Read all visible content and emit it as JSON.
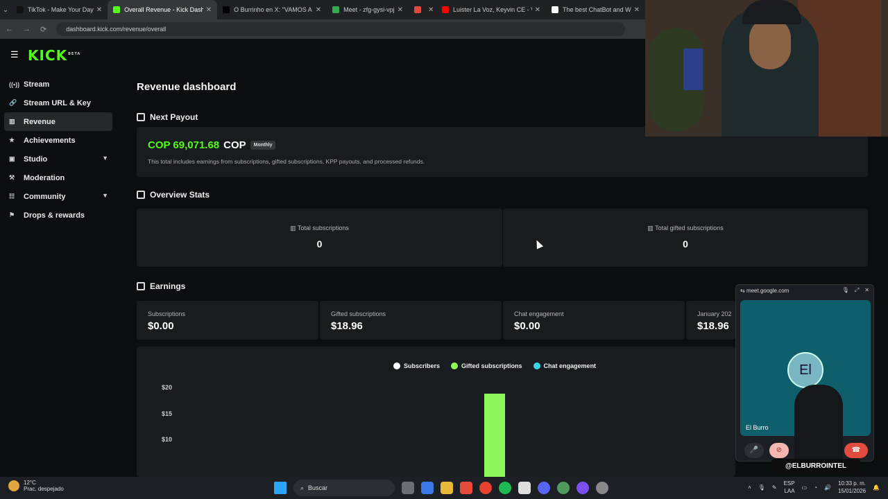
{
  "browser": {
    "tabs": [
      {
        "title": "TikTok - Make Your Day",
        "color": "#111111"
      },
      {
        "title": "Overall Revenue - Kick Dashbo",
        "color": "#53fc18"
      },
      {
        "title": "O Burrinho en X: \"VAMOS A Q",
        "color": "#000000"
      },
      {
        "title": "Meet - zfg-gysi-vpj",
        "color": "#34a853"
      },
      {
        "title": "",
        "color": "#e04a3f"
      },
      {
        "title": "Luister La Voz, Keyvin CE - Vue",
        "color": "#ff0000"
      },
      {
        "title": "The best ChatBot and W",
        "color": "#ffffff"
      }
    ],
    "url": "dashboard.kick.com/revenue/overall"
  },
  "sidebar": {
    "logo": "KICK",
    "logo_sup": "BETA",
    "items": [
      {
        "label": "Stream",
        "icon": "((•))"
      },
      {
        "label": "Stream URL & Key",
        "icon": "🔗"
      },
      {
        "label": "Revenue",
        "icon": "▥"
      },
      {
        "label": "Achievements",
        "icon": "★"
      },
      {
        "label": "Studio",
        "icon": "▣"
      },
      {
        "label": "Moderation",
        "icon": "⚒"
      },
      {
        "label": "Community",
        "icon": "☷"
      },
      {
        "label": "Drops & rewards",
        "icon": "⚑"
      }
    ]
  },
  "main": {
    "title": "Revenue dashboard",
    "payout": {
      "heading": "Next Payout",
      "amount": "COP 69,071.68",
      "currency": "COP",
      "badge": "Monthly",
      "note": "This total includes earnings from subscriptions, gifted subscriptions, KPP payouts, and processed refunds."
    },
    "overview": {
      "heading": "Overview Stats",
      "stats": [
        {
          "label": "Total subscriptions",
          "value": "0"
        },
        {
          "label": "Total gifted subscriptions",
          "value": "0"
        }
      ]
    },
    "earnings": {
      "heading": "Earnings",
      "items": [
        {
          "label": "Subscriptions",
          "value": "$0.00"
        },
        {
          "label": "Gifted subscriptions",
          "value": "$18.96"
        },
        {
          "label": "Chat engagement",
          "value": "$0.00"
        },
        {
          "label": "January 202",
          "value": "$18.96"
        }
      ]
    }
  },
  "chart_data": {
    "type": "bar",
    "series": [
      {
        "name": "Subscribers",
        "color": "#ffffff",
        "values": [
          0
        ]
      },
      {
        "name": "Gifted subscriptions",
        "color": "#8ef85a",
        "values": [
          18.96
        ]
      },
      {
        "name": "Chat engagement",
        "color": "#3ad6e8",
        "values": [
          0
        ]
      }
    ],
    "y_ticks": [
      "$20",
      "$15",
      "$10"
    ],
    "y_tick_values": [
      20,
      15,
      10
    ],
    "ylim": [
      0,
      20
    ],
    "legend_position": "top-center"
  },
  "meet": {
    "domain": "meet.google.com",
    "avatar": "El",
    "participant": "El Burro",
    "handle": "@ELBURROINTEL"
  },
  "taskbar": {
    "temp": "12°C",
    "weather": "Prac. despejado",
    "search": "Buscar",
    "lang1": "ESP",
    "lang2": "LAA",
    "time": "10:33 p. m.",
    "date": "15/01/2026"
  }
}
